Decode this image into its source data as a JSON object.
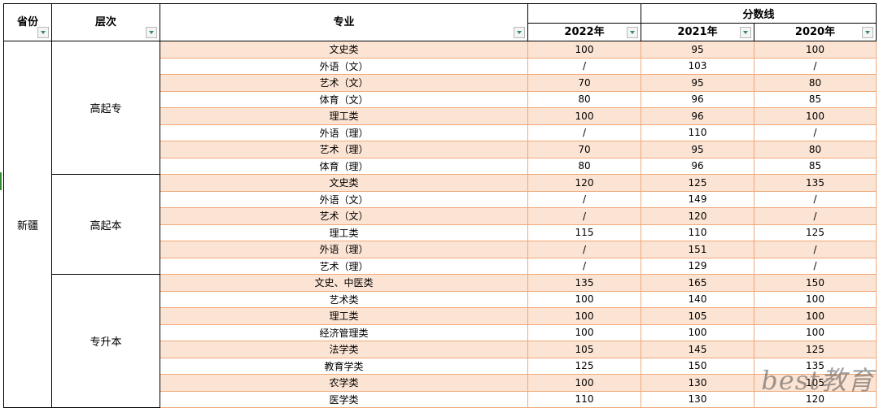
{
  "headers": {
    "province": "省份",
    "level": "层次",
    "major": "专业",
    "scores": "分数线",
    "years": [
      "2022年",
      "2021年",
      "2020年"
    ]
  },
  "province": "新疆",
  "groups": [
    {
      "level": "高起专",
      "rows": [
        {
          "major": "文史类",
          "y2022": "100",
          "y2021": "95",
          "y2020": "100"
        },
        {
          "major": "外语（文）",
          "y2022": "/",
          "y2021": "103",
          "y2020": "/"
        },
        {
          "major": "艺术（文）",
          "y2022": "70",
          "y2021": "95",
          "y2020": "80"
        },
        {
          "major": "体育（文）",
          "y2022": "80",
          "y2021": "96",
          "y2020": "85"
        },
        {
          "major": "理工类",
          "y2022": "100",
          "y2021": "96",
          "y2020": "100"
        },
        {
          "major": "外语（理）",
          "y2022": "/",
          "y2021": "110",
          "y2020": "/"
        },
        {
          "major": "艺术（理）",
          "y2022": "70",
          "y2021": "95",
          "y2020": "80"
        },
        {
          "major": "体育（理）",
          "y2022": "80",
          "y2021": "96",
          "y2020": "85"
        }
      ]
    },
    {
      "level": "高起本",
      "rows": [
        {
          "major": "文史类",
          "y2022": "120",
          "y2021": "125",
          "y2020": "135"
        },
        {
          "major": "外语（文）",
          "y2022": "/",
          "y2021": "149",
          "y2020": "/"
        },
        {
          "major": "艺术（文）",
          "y2022": "/",
          "y2021": "120",
          "y2020": "/"
        },
        {
          "major": "理工类",
          "y2022": "115",
          "y2021": "110",
          "y2020": "125"
        },
        {
          "major": "外语（理）",
          "y2022": "/",
          "y2021": "151",
          "y2020": "/"
        },
        {
          "major": "艺术（理）",
          "y2022": "/",
          "y2021": "129",
          "y2020": "/"
        }
      ]
    },
    {
      "level": "专升本",
      "rows": [
        {
          "major": "文史、中医类",
          "y2022": "135",
          "y2021": "165",
          "y2020": "150"
        },
        {
          "major": "艺术类",
          "y2022": "100",
          "y2021": "140",
          "y2020": "100"
        },
        {
          "major": "理工类",
          "y2022": "100",
          "y2021": "105",
          "y2020": "100"
        },
        {
          "major": "经济管理类",
          "y2022": "100",
          "y2021": "100",
          "y2020": "100"
        },
        {
          "major": "法学类",
          "y2022": "105",
          "y2021": "145",
          "y2020": "125"
        },
        {
          "major": "教育学类",
          "y2022": "125",
          "y2021": "150",
          "y2020": "135"
        },
        {
          "major": "农学类",
          "y2022": "100",
          "y2021": "130",
          "y2020": "105"
        },
        {
          "major": "医学类",
          "y2022": "110",
          "y2021": "130",
          "y2020": "120"
        }
      ]
    }
  ],
  "watermark": "best教育",
  "colors": {
    "row_tint": "#fce4d4",
    "row_border": "#f0a878",
    "filter_arrow": "#2f8f5a"
  }
}
